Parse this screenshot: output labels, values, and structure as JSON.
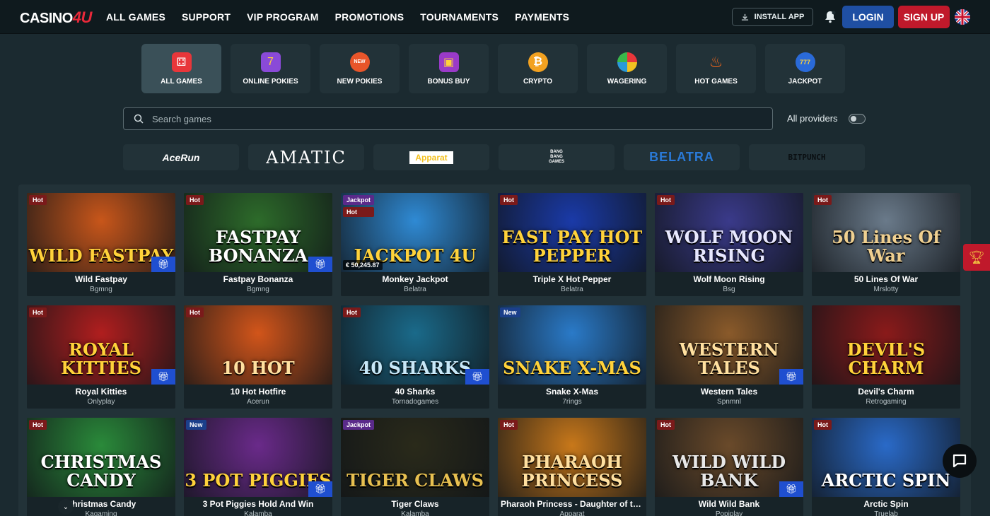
{
  "header": {
    "logo_text": "CASINO",
    "logo_accent": "4U",
    "nav": [
      "ALL GAMES",
      "SUPPORT",
      "VIP PROGRAM",
      "PROMOTIONS",
      "TOURNAMENTS",
      "PAYMENTS"
    ],
    "install_label": "INSTALL APP",
    "login_label": "LOGIN",
    "signup_label": "SIGN UP",
    "language": "en-GB"
  },
  "categories": [
    {
      "label": "ALL GAMES",
      "icon": "dice-icon",
      "active": true
    },
    {
      "label": "ONLINE POKIES",
      "icon": "slot-machine-icon"
    },
    {
      "label": "NEW POKIES",
      "icon": "new-badge-icon"
    },
    {
      "label": "BONUS BUY",
      "icon": "treasure-chest-icon"
    },
    {
      "label": "CRYPTO",
      "icon": "bitcoin-icon"
    },
    {
      "label": "WAGERING",
      "icon": "wheel-icon"
    },
    {
      "label": "HOT GAMES",
      "icon": "fire-icon"
    },
    {
      "label": "JACKPOT",
      "icon": "777-icon"
    }
  ],
  "search": {
    "placeholder": "Search games",
    "value": ""
  },
  "providers_filter": {
    "label": "All providers",
    "enabled": false
  },
  "providers": [
    "AceRun",
    "AMATIC",
    "Apparat",
    "BANG BANG GAMES",
    "BELATRA",
    "BITPUNCH"
  ],
  "games": [
    {
      "name": "Wild Fastpay",
      "provider": "Bgmng",
      "badges": [
        "Hot"
      ],
      "gift": true,
      "art": "WILD FASTPAY",
      "bg": "#c8561a",
      "fg": "#ffd23a"
    },
    {
      "name": "Fastpay Bonanza",
      "provider": "Bgmng",
      "badges": [
        "Hot"
      ],
      "gift": true,
      "art": "FASTPAY BONANZA",
      "bg": "#2d6b2a",
      "fg": "#ffffff"
    },
    {
      "name": "Monkey Jackpot",
      "provider": "Belatra",
      "badges": [
        "Jackpot",
        "Hot"
      ],
      "gift": false,
      "jackpot_value": "€ 50,245.87",
      "art": "JACKPOT 4U",
      "bg": "#2f8ad4",
      "fg": "#ffd23a"
    },
    {
      "name": "Triple X Hot Pepper",
      "provider": "Belatra",
      "badges": [
        "Hot"
      ],
      "gift": false,
      "art": "FAST PAY HOT PEPPER",
      "bg": "#1a3aa8",
      "fg": "#ffd23a"
    },
    {
      "name": "Wolf Moon Rising",
      "provider": "Bsg",
      "badges": [
        "Hot"
      ],
      "gift": false,
      "art": "WOLF MOON RISING",
      "bg": "#3a3a8a",
      "fg": "#e8e8ff"
    },
    {
      "name": "50 Lines Of War",
      "provider": "Mrslotty",
      "badges": [
        "Hot"
      ],
      "gift": false,
      "art": "50 Lines Of War",
      "bg": "#6a7a8a",
      "fg": "#f0d090"
    },
    {
      "name": "Royal Kitties",
      "provider": "Onlyplay",
      "badges": [
        "Hot"
      ],
      "gift": true,
      "art": "ROYAL KITTIES",
      "bg": "#b01e1e",
      "fg": "#ffd23a"
    },
    {
      "name": "10 Hot Hotfire",
      "provider": "Acerun",
      "badges": [
        "Hot"
      ],
      "gift": false,
      "art": "10 HOT",
      "bg": "#d2551a",
      "fg": "#ffe0a0"
    },
    {
      "name": "40 Sharks",
      "provider": "Tornadogames",
      "badges": [
        "Hot"
      ],
      "gift": true,
      "art": "40 SHARKS",
      "bg": "#1a6a8a",
      "fg": "#c8e8f8"
    },
    {
      "name": "Snake X-Mas",
      "provider": "7rings",
      "badges": [
        "New"
      ],
      "gift": false,
      "art": "SNAKE X-MAS",
      "bg": "#2a7ac8",
      "fg": "#ffd23a"
    },
    {
      "name": "Western Tales",
      "provider": "Spnmnl",
      "badges": [],
      "gift": true,
      "art": "WESTERN TALES",
      "bg": "#8a5a2a",
      "fg": "#ffe0a0"
    },
    {
      "name": "Devil's Charm",
      "provider": "Retrogaming",
      "badges": [],
      "gift": false,
      "art": "DEVIL'S CHARM",
      "bg": "#8a1a1a",
      "fg": "#ffd23a"
    },
    {
      "name": "Christmas Candy",
      "provider": "Kagaming",
      "badges": [
        "Hot"
      ],
      "gift": false,
      "art": "CHRISTMAS CANDY",
      "bg": "#2a8a3a",
      "fg": "#ffffff"
    },
    {
      "name": "3 Pot Piggies Hold And Win",
      "provider": "Kalamba",
      "badges": [
        "New"
      ],
      "gift": true,
      "art": "3 POT PIGGIES",
      "bg": "#6a2a8a",
      "fg": "#ffd23a"
    },
    {
      "name": "Tiger Claws",
      "provider": "Kalamba",
      "badges": [
        "Jackpot"
      ],
      "gift": false,
      "art": "TIGER CLAWS",
      "bg": "#2a2a1a",
      "fg": "#e8c050"
    },
    {
      "name": "Pharaoh Princess - Daughter of the Nile",
      "provider": "Apparat",
      "badges": [
        "Hot"
      ],
      "gift": false,
      "art": "PHARAOH PRINCESS",
      "bg": "#c8781a",
      "fg": "#ffe0a0"
    },
    {
      "name": "Wild Wild Bank",
      "provider": "Popiplay",
      "badges": [
        "Hot"
      ],
      "gift": true,
      "art": "WILD WILD BANK",
      "bg": "#6a4a2a",
      "fg": "#e8e8e8"
    },
    {
      "name": "Arctic Spin",
      "provider": "Truelab",
      "badges": [
        "Hot"
      ],
      "gift": false,
      "art": "ARCTIC SPIN",
      "bg": "#2a6ac8",
      "fg": "#ffffff"
    }
  ]
}
